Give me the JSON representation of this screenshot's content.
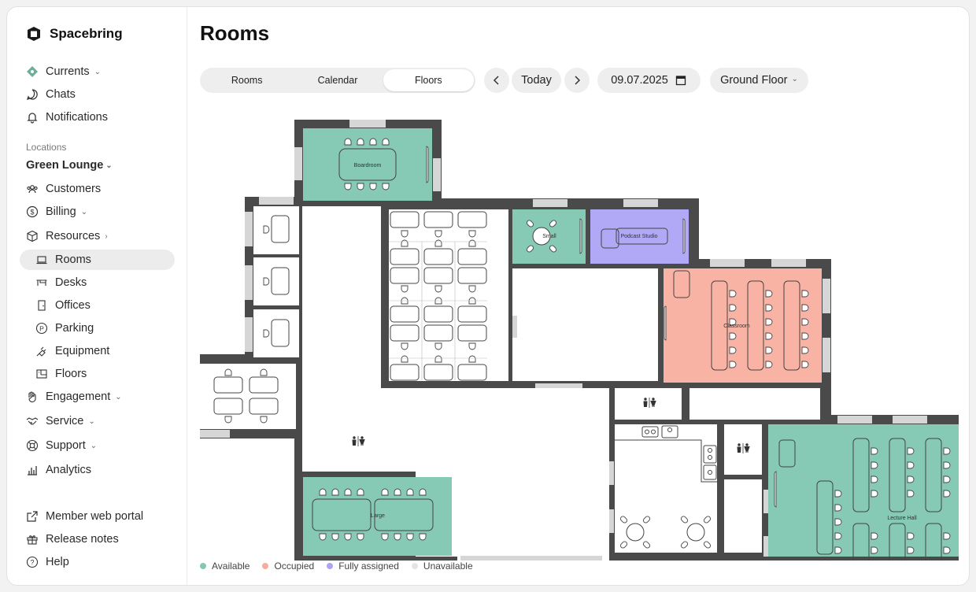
{
  "brand": {
    "name": "Spacebring"
  },
  "nav": {
    "currents": "Currents",
    "chats": "Chats",
    "notifications": "Notifications",
    "locations_label": "Locations",
    "location": "Green Lounge",
    "customers": "Customers",
    "billing": "Billing",
    "resources": "Resources",
    "rooms": "Rooms",
    "desks": "Desks",
    "offices": "Offices",
    "parking": "Parking",
    "equipment": "Equipment",
    "floors": "Floors",
    "engagement": "Engagement",
    "service": "Service",
    "support": "Support",
    "analytics": "Analytics",
    "member_portal": "Member web portal",
    "release_notes": "Release notes",
    "help": "Help"
  },
  "page": {
    "title": "Rooms"
  },
  "view_tabs": [
    {
      "label": "Rooms",
      "active": false
    },
    {
      "label": "Calendar",
      "active": false
    },
    {
      "label": "Floors",
      "active": true
    }
  ],
  "toolbar": {
    "today": "Today",
    "date": "09.07.2025",
    "floor": "Ground Floor"
  },
  "rooms": {
    "boardroom": "Boardroom",
    "small": "Small",
    "podcast": "Podcast Studio",
    "classroom": "Classroom",
    "large": "Large",
    "lecture": "Lecture Hall"
  },
  "legend": [
    {
      "label": "Available",
      "color": "#84c8b4"
    },
    {
      "label": "Occupied",
      "color": "#f7ad9e"
    },
    {
      "label": "Fully assigned",
      "color": "#ada3f5"
    },
    {
      "label": "Unavailable",
      "color": "#e4e4e4"
    }
  ],
  "colors": {
    "available": "#86c9b5",
    "occupied": "#f8b3a5",
    "fully_assigned": "#b1a9f6",
    "wall": "#4a4a4a"
  }
}
